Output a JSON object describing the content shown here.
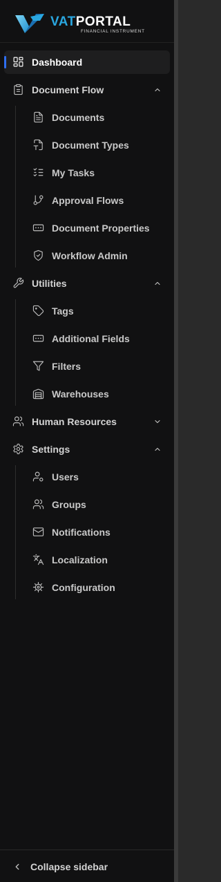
{
  "brand": {
    "name_part1": "VAT",
    "name_part2": "PORTAL",
    "tagline": "FINANCIAL INSTRUMENT",
    "accent_color": "#2aa7e0"
  },
  "nav": {
    "dashboard": {
      "label": "Dashboard",
      "icon": "grid-icon"
    },
    "document_flow": {
      "label": "Document Flow",
      "icon": "clipboard-icon",
      "expanded": true,
      "items": [
        {
          "label": "Documents",
          "icon": "file-text-icon"
        },
        {
          "label": "Document Types",
          "icon": "file-type-icon"
        },
        {
          "label": "My Tasks",
          "icon": "list-checks-icon"
        },
        {
          "label": "Approval Flows",
          "icon": "git-branch-icon"
        },
        {
          "label": "Document Properties",
          "icon": "rectangle-ellipsis-icon"
        },
        {
          "label": "Workflow Admin",
          "icon": "shield-check-icon"
        }
      ]
    },
    "utilities": {
      "label": "Utilities",
      "icon": "wrench-icon",
      "expanded": true,
      "items": [
        {
          "label": "Tags",
          "icon": "tag-icon"
        },
        {
          "label": "Additional Fields",
          "icon": "rectangle-ellipsis-icon"
        },
        {
          "label": "Filters",
          "icon": "funnel-icon"
        },
        {
          "label": "Warehouses",
          "icon": "warehouse-icon"
        }
      ]
    },
    "human_resources": {
      "label": "Human Resources",
      "icon": "users-icon",
      "expanded": false
    },
    "settings": {
      "label": "Settings",
      "icon": "gear-icon",
      "expanded": true,
      "items": [
        {
          "label": "Users",
          "icon": "user-cog-icon"
        },
        {
          "label": "Groups",
          "icon": "users-icon"
        },
        {
          "label": "Notifications",
          "icon": "mail-icon"
        },
        {
          "label": "Localization",
          "icon": "languages-icon"
        },
        {
          "label": "Configuration",
          "icon": "cog-icon"
        }
      ]
    }
  },
  "footer": {
    "collapse_label": "Collapse sidebar",
    "icon": "chevron-left-icon"
  },
  "colors": {
    "background": "#111112",
    "active_indicator": "#2f6ff2",
    "active_bg": "#1e1e1f"
  }
}
